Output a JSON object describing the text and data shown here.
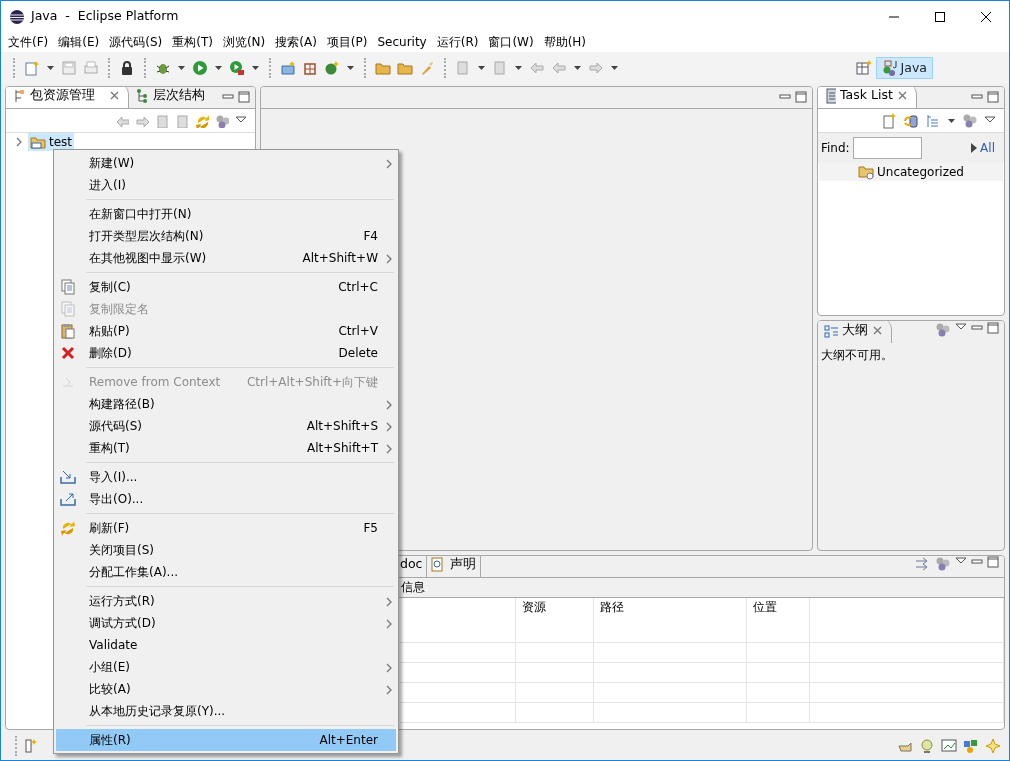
{
  "window": {
    "title": "Java  -  Eclipse Platform"
  },
  "menu_bar": [
    {
      "label": "文件(F)"
    },
    {
      "label": "编辑(E)"
    },
    {
      "label": "源代码(S)"
    },
    {
      "label": "重构(T)"
    },
    {
      "label": "浏览(N)"
    },
    {
      "label": "搜索(A)"
    },
    {
      "label": "项目(P)"
    },
    {
      "label": "Security"
    },
    {
      "label": "运行(R)"
    },
    {
      "label": "窗口(W)"
    },
    {
      "label": "帮助(H)"
    }
  ],
  "perspective": {
    "label": "Java",
    "selected": true
  },
  "package_explorer": {
    "tabs": [
      {
        "label": "包资源管理",
        "selected": true
      },
      {
        "label": "层次结构",
        "selected": false
      }
    ],
    "tree": [
      {
        "label": "test",
        "selected": true,
        "expanded": false
      }
    ]
  },
  "task_list": {
    "tab": "Task List",
    "find_label": "Find:",
    "all_link": "All",
    "category": "Uncategorized"
  },
  "outline": {
    "tab": "大纲",
    "message": "大纲不可用。"
  },
  "bottom_panel": {
    "tabs": [
      {
        "label": "doc",
        "selected": false
      },
      {
        "label": "声明",
        "selected": false
      }
    ],
    "heading": "信息",
    "columns": [
      "资源",
      "路径",
      "位置"
    ]
  },
  "context_menu": [
    {
      "kind": "item",
      "label": "新建(W)",
      "submenu": true,
      "disabled": false,
      "selected": false
    },
    {
      "kind": "item",
      "label": "进入(I)",
      "submenu": false,
      "disabled": false,
      "selected": false
    },
    {
      "kind": "separator"
    },
    {
      "kind": "item",
      "label": "在新窗口中打开(N)",
      "submenu": false,
      "disabled": false,
      "selected": false
    },
    {
      "kind": "item",
      "label": "打开类型层次结构(N)",
      "shortcut": "F4",
      "submenu": false,
      "disabled": false,
      "selected": false
    },
    {
      "kind": "item",
      "label": "在其他视图中显示(W)",
      "shortcut": "Alt+Shift+W",
      "submenu": true,
      "disabled": false,
      "selected": false
    },
    {
      "kind": "separator"
    },
    {
      "kind": "item",
      "label": "复制(C)",
      "shortcut": "Ctrl+C",
      "submenu": false,
      "disabled": false,
      "selected": false
    },
    {
      "kind": "item",
      "label": "复制限定名",
      "submenu": false,
      "disabled": true,
      "selected": false
    },
    {
      "kind": "item",
      "label": "粘贴(P)",
      "shortcut": "Ctrl+V",
      "submenu": false,
      "disabled": false,
      "selected": false
    },
    {
      "kind": "item",
      "label": "删除(D)",
      "shortcut": "Delete",
      "submenu": false,
      "disabled": false,
      "selected": false
    },
    {
      "kind": "separator"
    },
    {
      "kind": "item",
      "label": "Remove from Context",
      "shortcut": "Ctrl+Alt+Shift+向下键",
      "submenu": false,
      "disabled": true,
      "selected": false
    },
    {
      "kind": "item",
      "label": "构建路径(B)",
      "submenu": true,
      "disabled": false,
      "selected": false
    },
    {
      "kind": "item",
      "label": "源代码(S)",
      "shortcut": "Alt+Shift+S",
      "submenu": true,
      "disabled": false,
      "selected": false
    },
    {
      "kind": "item",
      "label": "重构(T)",
      "shortcut": "Alt+Shift+T",
      "submenu": true,
      "disabled": false,
      "selected": false
    },
    {
      "kind": "separator"
    },
    {
      "kind": "item",
      "label": "导入(I)...",
      "submenu": false,
      "disabled": false,
      "selected": false
    },
    {
      "kind": "item",
      "label": "导出(O)...",
      "submenu": false,
      "disabled": false,
      "selected": false
    },
    {
      "kind": "separator"
    },
    {
      "kind": "item",
      "label": "刷新(F)",
      "shortcut": "F5",
      "submenu": false,
      "disabled": false,
      "selected": false
    },
    {
      "kind": "item",
      "label": "关闭项目(S)",
      "submenu": false,
      "disabled": false,
      "selected": false
    },
    {
      "kind": "item",
      "label": "分配工作集(A)...",
      "submenu": false,
      "disabled": false,
      "selected": false
    },
    {
      "kind": "separator"
    },
    {
      "kind": "item",
      "label": "运行方式(R)",
      "submenu": true,
      "disabled": false,
      "selected": false
    },
    {
      "kind": "item",
      "label": "调试方式(D)",
      "submenu": true,
      "disabled": false,
      "selected": false
    },
    {
      "kind": "item",
      "label": "Validate",
      "submenu": false,
      "disabled": false,
      "selected": false
    },
    {
      "kind": "item",
      "label": "小组(E)",
      "submenu": true,
      "disabled": false,
      "selected": false
    },
    {
      "kind": "item",
      "label": "比较(A)",
      "submenu": true,
      "disabled": false,
      "selected": false
    },
    {
      "kind": "item",
      "label": "从本地历史记录复原(Y)...",
      "submenu": false,
      "disabled": false,
      "selected": false
    },
    {
      "kind": "separator"
    },
    {
      "kind": "item",
      "label": "属性(R)",
      "shortcut": "Alt+Enter",
      "submenu": false,
      "disabled": false,
      "selected": true
    }
  ]
}
